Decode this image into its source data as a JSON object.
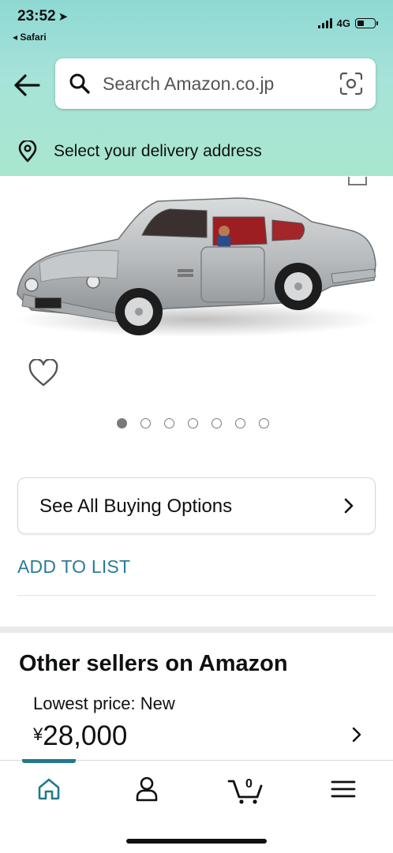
{
  "status_bar": {
    "time": "23:52",
    "back_app": "◂ Safari",
    "network": "4G"
  },
  "search": {
    "placeholder": "Search Amazon.co.jp"
  },
  "delivery": {
    "text": "Select your delivery address"
  },
  "gallery": {
    "image_count": 7,
    "active_index": 0
  },
  "buy_options": {
    "label": "See All Buying Options"
  },
  "add_to_list": {
    "label": "ADD TO LIST"
  },
  "other_sellers": {
    "title": "Other sellers on Amazon",
    "lowest_label": "Lowest price: New",
    "currency": "¥",
    "price": "28,000"
  },
  "tabbar": {
    "cart_count": "0",
    "active_tab": "home"
  },
  "colors": {
    "header_gradient_top": "#8fd8d4",
    "header_gradient_bottom": "#a9e6cf",
    "link": "#2a7d98",
    "tab_indicator": "#1f7a8c",
    "text": "#0f1111"
  }
}
